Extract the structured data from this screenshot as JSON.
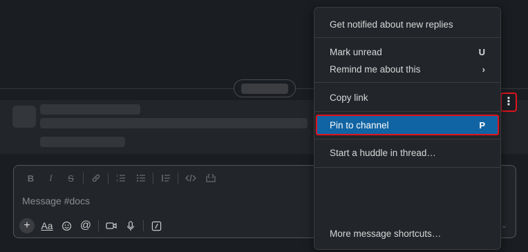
{
  "composer": {
    "placeholder": "Message #docs",
    "format_toolbar": [
      "bold-icon",
      "italic-icon",
      "strikethrough-icon",
      "link-icon",
      "ordered-list-icon",
      "bulleted-list-icon",
      "blockquote-icon",
      "code-icon",
      "code-block-icon"
    ],
    "bottom_toolbar": [
      "plus-icon",
      "text-format-icon",
      "emoji-icon",
      "mention-icon",
      "video-icon",
      "microphone-icon",
      "slash-command-icon"
    ],
    "aa_label": "Aa"
  },
  "more_actions": {
    "icon": "vertical-ellipsis-icon",
    "glyph": "⋮"
  },
  "menu": {
    "items": [
      {
        "label": "Get notified about new replies",
        "shortcut": ""
      },
      {
        "label": "Mark unread",
        "shortcut": "U"
      },
      {
        "label": "Remind me about this",
        "shortcut": "›"
      },
      {
        "label": "Copy link",
        "shortcut": ""
      },
      {
        "label": "Pin to channel",
        "shortcut": "P",
        "highlighted": true
      },
      {
        "label": "Start a huddle in thread…",
        "shortcut": ""
      },
      {
        "label": "More message shortcuts…",
        "shortcut": ""
      }
    ]
  },
  "colors": {
    "background": "#1a1d21",
    "menu_highlight": "#1164a3",
    "annotation_outline": "#e0141e"
  }
}
